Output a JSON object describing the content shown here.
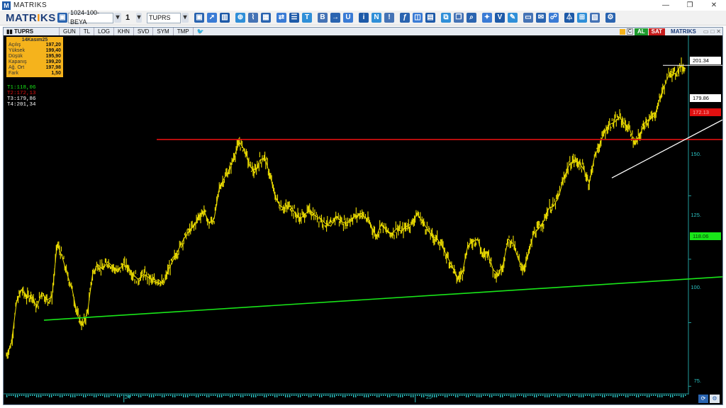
{
  "window": {
    "title": "MATRIKS",
    "minimize": "—",
    "restore": "❐",
    "close": "✕"
  },
  "toolbar": {
    "brand_prefix": "MATR",
    "brand_dot": "I",
    "brand_suffix": "KS",
    "layout_select": "1024-100-BEYA",
    "window_number": "1",
    "symbol_select": "TUPRS",
    "icons": [
      "save-icon",
      "cursor-icon",
      "chart-type-icon",
      "zoom-icon",
      "indicator-icon",
      "layout-icon",
      "compare-icon",
      "list-icon",
      "text-icon",
      "bold-icon",
      "arrow-icon",
      "u-icon",
      "info-icon",
      "news-icon",
      "alert-icon",
      "fx-icon",
      "data-icon",
      "table-icon",
      "copy-icon",
      "window-icon",
      "search-icon",
      "bird-icon",
      "v-icon",
      "pencil-icon",
      "screen-icon",
      "mail-icon",
      "sign-icon",
      "bell-icon",
      "grid-icon",
      "calc-icon",
      "settings-icon"
    ]
  },
  "panel": {
    "symbol": "TUPRS",
    "tabs": [
      "GUN",
      "TL",
      "LOG",
      "KHN",
      "SVD",
      "SYM",
      "TMP"
    ],
    "al_label": "AL",
    "sat_label": "SAT",
    "brand": "MATRIKS",
    "c_label": "C"
  },
  "infobox": {
    "title": "14Kasım25",
    "rows": [
      {
        "label": "Açılış",
        "value": "197,20"
      },
      {
        "label": "Yüksek",
        "value": "199,40"
      },
      {
        "label": "Düşük",
        "value": "195,90"
      },
      {
        "label": "Kapanış",
        "value": "199,20"
      },
      {
        "label": "Ağ. Ort",
        "value": "197,98"
      },
      {
        "label": "Fark",
        "value": "1,50"
      }
    ]
  },
  "trendlines": {
    "t1": "T1:118,06",
    "t2": "T2:172,13",
    "t3": "T3:179,86",
    "t4": "T4:201,34"
  },
  "price_tags": {
    "t4": "201.34",
    "t3": "179.86",
    "t2": "172.13",
    "t1": "118.06"
  },
  "colors": {
    "price": "#f0e000",
    "t1": "#19e619",
    "t2": "#e01010",
    "t3": "#ffffff",
    "t4": "#ffffff",
    "axis": "#2bc3c3"
  },
  "chart_data": {
    "type": "line",
    "y_axis_labels": [
      "150.",
      "125.",
      "100.",
      "75."
    ],
    "y_axis_values": [
      150,
      125,
      100,
      75
    ],
    "ylim": [
      72,
      212
    ],
    "x_axis_labels": [
      "24",
      "25"
    ],
    "x_axis_label_positions": [
      0.173,
      0.602
    ],
    "series": [
      {
        "values": [
          87,
          92,
          108,
          113,
          110,
          111,
          106,
          112,
          109,
          110,
          131,
          126,
          119,
          113,
          103,
          99,
          104,
          119,
          123,
          121,
          124,
          122,
          120,
          123,
          122,
          119,
          117,
          119,
          118,
          116,
          117,
          115,
          121,
          125,
          129,
          133,
          136,
          138,
          142,
          144,
          139,
          141,
          153,
          157,
          160,
          166,
          171,
          168,
          162,
          159,
          164,
          165,
          158,
          150,
          146,
          145,
          146,
          143,
          141,
          143,
          144,
          142,
          141,
          139,
          138,
          142,
          140,
          139,
          141,
          142,
          143,
          141,
          138,
          134,
          139,
          136,
          135,
          137,
          136,
          138,
          139,
          143,
          140,
          137,
          134,
          133,
          130,
          126,
          122,
          117,
          120,
          130,
          132,
          133,
          126,
          128,
          121,
          119,
          123,
          133,
          131,
          125,
          121,
          127,
          135,
          137,
          140,
          145,
          146,
          150,
          157,
          162,
          164,
          163,
          160,
          155,
          165,
          170,
          175,
          178,
          179,
          181,
          178,
          176,
          170,
          174,
          179,
          180,
          182,
          189,
          194,
          199,
          198,
          201,
          200
        ]
      }
    ],
    "trendline_values": {
      "T1": 118.06,
      "T2": 172.13,
      "T3": 179.86,
      "T4": 201.34
    }
  }
}
